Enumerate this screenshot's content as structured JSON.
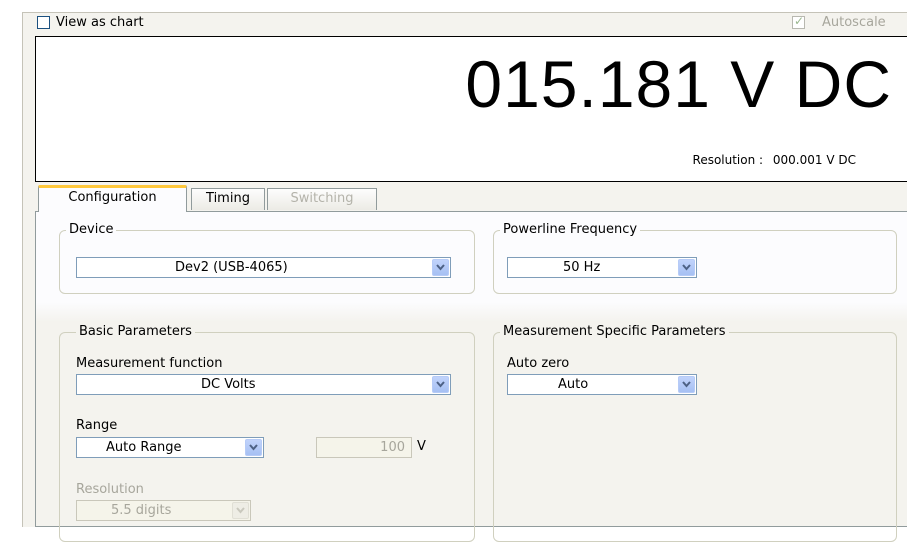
{
  "header": {
    "view_as_chart_label": "View as chart",
    "autoscale_label": "Autoscale"
  },
  "display": {
    "reading": "015.181 V DC",
    "resolution_label": "Resolution :",
    "resolution_value": "000.001 V DC"
  },
  "tabs": [
    {
      "label": "Configuration"
    },
    {
      "label": "Timing"
    },
    {
      "label": "Switching"
    }
  ],
  "device": {
    "legend": "Device",
    "value": "Dev2 (USB-4065)"
  },
  "powerline": {
    "legend": "Powerline Frequency",
    "value": "50 Hz"
  },
  "basic": {
    "legend": "Basic Parameters",
    "function_label": "Measurement function",
    "function_value": "DC Volts",
    "range_label": "Range",
    "range_value": "Auto Range",
    "range_number": "100",
    "range_unit": "V",
    "resolution_label": "Resolution",
    "resolution_value": "5.5 digits"
  },
  "specific": {
    "legend": "Measurement Specific Parameters",
    "autozero_label": "Auto zero",
    "autozero_value": "Auto"
  }
}
